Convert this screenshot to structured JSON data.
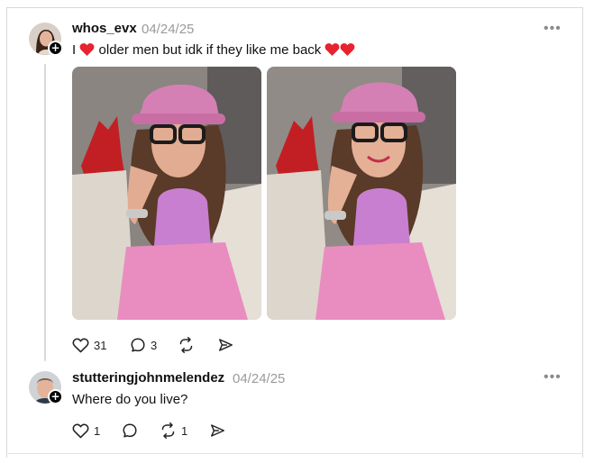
{
  "post": {
    "username": "whos_evx",
    "timestamp": "04/24/25",
    "text_before": "I",
    "text_middle": "older men but idk if they like me back",
    "likes": "31",
    "replies": "3",
    "icons": [
      "heart-icon",
      "comment-icon",
      "repost-icon",
      "share-icon"
    ],
    "image_count": 2
  },
  "reply": {
    "username": "stutteringjohnmelendez",
    "timestamp": "04/24/25",
    "text": "Where do you live?",
    "likes": "1",
    "reposts": "1"
  },
  "colors": {
    "heart_emoji": "#e8222e",
    "muted": "#9a9a9a",
    "photo_pink": "#d98fc7"
  }
}
